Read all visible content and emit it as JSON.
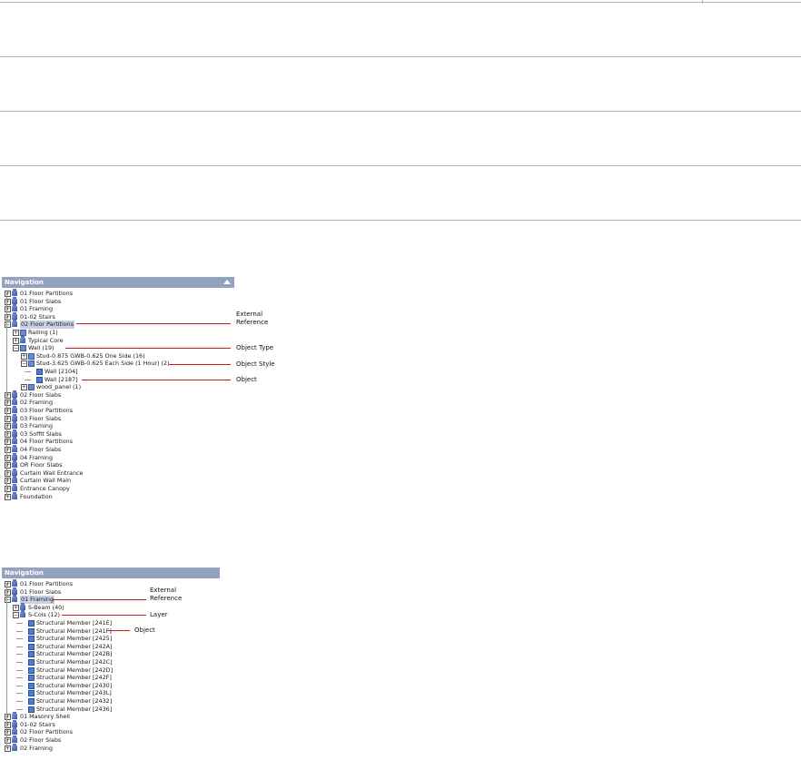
{
  "panel1": {
    "title": "Navigation",
    "items": [
      {
        "label": "01 Floor Partitions",
        "depth": 0,
        "exp": "+",
        "icon": "ref"
      },
      {
        "label": "01 Floor Slabs",
        "depth": 0,
        "exp": "+",
        "icon": "ref"
      },
      {
        "label": "01 Framing",
        "depth": 0,
        "exp": "+",
        "icon": "ref"
      },
      {
        "label": "01-02 Stairs",
        "depth": 0,
        "exp": "+",
        "icon": "ref"
      },
      {
        "label": "02 Floor Partitions",
        "depth": 0,
        "exp": "-",
        "icon": "ref",
        "selected": true
      },
      {
        "label": "Railing (1)",
        "depth": 1,
        "exp": "+",
        "icon": "type"
      },
      {
        "label": "Typical Core",
        "depth": 1,
        "exp": "+",
        "icon": "ref"
      },
      {
        "label": "Wall (19)",
        "depth": 1,
        "exp": "-",
        "icon": "type"
      },
      {
        "label": "Stud-0.875 GWB-0.625 One Side (16)",
        "depth": 2,
        "exp": "+",
        "icon": "type"
      },
      {
        "label": "Stud-3.625 GWB-0.625 Each Side (1 Hour) (2)",
        "depth": 2,
        "exp": "-",
        "icon": "type"
      },
      {
        "label": "Wall [2104]",
        "depth": 3,
        "exp": "",
        "icon": "obj"
      },
      {
        "label": "Wall [2187]",
        "depth": 3,
        "exp": "",
        "icon": "obj"
      },
      {
        "label": "wood_panel (1)",
        "depth": 2,
        "exp": "+",
        "icon": "type"
      },
      {
        "label": "02 Floor Slabs",
        "depth": 0,
        "exp": "+",
        "icon": "ref"
      },
      {
        "label": "02 Framing",
        "depth": 0,
        "exp": "+",
        "icon": "ref"
      },
      {
        "label": "03 Floor Partitions",
        "depth": 0,
        "exp": "+",
        "icon": "ref"
      },
      {
        "label": "03 Floor Slabs",
        "depth": 0,
        "exp": "+",
        "icon": "ref"
      },
      {
        "label": "03 Framing",
        "depth": 0,
        "exp": "+",
        "icon": "ref"
      },
      {
        "label": "03 Soffit Slabs",
        "depth": 0,
        "exp": "+",
        "icon": "ref"
      },
      {
        "label": "04 Floor Partitions",
        "depth": 0,
        "exp": "+",
        "icon": "ref"
      },
      {
        "label": "04 Floor Slabs",
        "depth": 0,
        "exp": "+",
        "icon": "ref"
      },
      {
        "label": "04 Framing",
        "depth": 0,
        "exp": "+",
        "icon": "ref"
      },
      {
        "label": "OR Floor Slabs",
        "depth": 0,
        "exp": "+",
        "icon": "ref"
      },
      {
        "label": "Curtain Wall Entrance",
        "depth": 0,
        "exp": "+",
        "icon": "ref"
      },
      {
        "label": "Curtain Wall Main",
        "depth": 0,
        "exp": "+",
        "icon": "ref"
      },
      {
        "label": "Entrance Canopy",
        "depth": 0,
        "exp": "+",
        "icon": "ref"
      },
      {
        "label": "Foundation",
        "depth": 0,
        "exp": "+",
        "icon": "ref"
      }
    ],
    "callouts": {
      "external_reference_1": "External",
      "external_reference_2": "Reference",
      "object_type": "Object Type",
      "object_style": "Object Style",
      "object": "Object"
    }
  },
  "panel2": {
    "title": "Navigation",
    "items": [
      {
        "label": "01 Floor Partitions",
        "depth": 0,
        "exp": "+",
        "icon": "ref"
      },
      {
        "label": "01 Floor Slabs",
        "depth": 0,
        "exp": "+",
        "icon": "ref"
      },
      {
        "label": "01 Framing",
        "depth": 0,
        "exp": "-",
        "icon": "ref",
        "selected": true
      },
      {
        "label": "S-Beam (40)",
        "depth": 1,
        "exp": "+",
        "icon": "ref"
      },
      {
        "label": "S-Cols (12)",
        "depth": 1,
        "exp": "-",
        "icon": "ref"
      },
      {
        "label": "Structural Member [241E]",
        "depth": 2,
        "exp": "",
        "icon": "obj"
      },
      {
        "label": "Structural Member [241F]",
        "depth": 2,
        "exp": "",
        "icon": "obj"
      },
      {
        "label": "Structural Member [2425]",
        "depth": 2,
        "exp": "",
        "icon": "obj"
      },
      {
        "label": "Structural Member [242A]",
        "depth": 2,
        "exp": "",
        "icon": "obj"
      },
      {
        "label": "Structural Member [242B]",
        "depth": 2,
        "exp": "",
        "icon": "obj"
      },
      {
        "label": "Structural Member [242C]",
        "depth": 2,
        "exp": "",
        "icon": "obj"
      },
      {
        "label": "Structural Member [242D]",
        "depth": 2,
        "exp": "",
        "icon": "obj"
      },
      {
        "label": "Structural Member [242F]",
        "depth": 2,
        "exp": "",
        "icon": "obj"
      },
      {
        "label": "Structural Member [2430]",
        "depth": 2,
        "exp": "",
        "icon": "obj"
      },
      {
        "label": "Structural Member [243L]",
        "depth": 2,
        "exp": "",
        "icon": "obj"
      },
      {
        "label": "Structural Member [2432]",
        "depth": 2,
        "exp": "",
        "icon": "obj"
      },
      {
        "label": "Structural Member [2436]",
        "depth": 2,
        "exp": "",
        "icon": "obj"
      },
      {
        "label": "01 Masonry Shell",
        "depth": 0,
        "exp": "+",
        "icon": "ref"
      },
      {
        "label": "01-02 Stairs",
        "depth": 0,
        "exp": "+",
        "icon": "ref"
      },
      {
        "label": "02 Floor Partitions",
        "depth": 0,
        "exp": "+",
        "icon": "ref"
      },
      {
        "label": "02 Floor Slabs",
        "depth": 0,
        "exp": "+",
        "icon": "ref"
      },
      {
        "label": "02 Framing",
        "depth": 0,
        "exp": "+",
        "icon": "ref"
      }
    ],
    "callouts": {
      "external_reference_1": "External",
      "external_reference_2": "Reference",
      "layer": "Layer",
      "object": "Object"
    }
  },
  "colors": {
    "titlebar": "#94a3bd",
    "callout_line": "#cc1f1f",
    "selection": "#c9d1e4"
  }
}
